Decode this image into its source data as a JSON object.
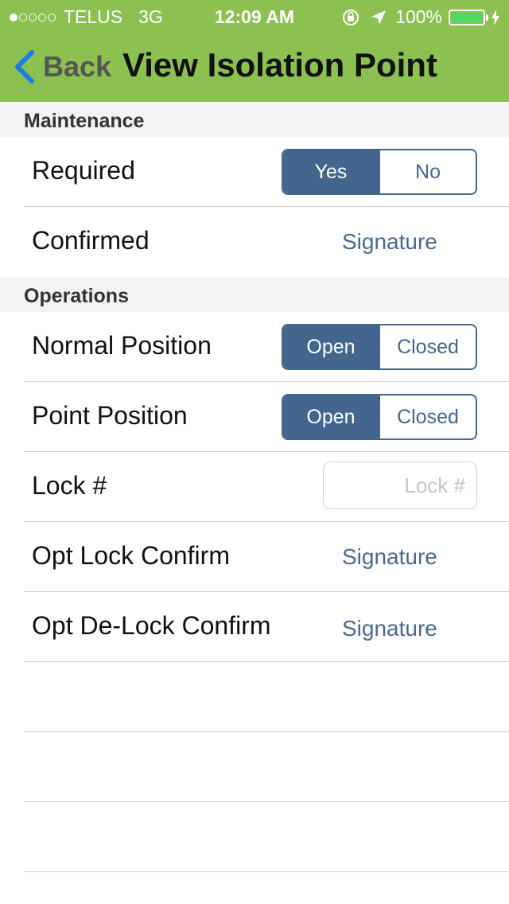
{
  "status_bar": {
    "signal_dots_filled": 1,
    "signal_dots_total": 5,
    "carrier": "TELUS",
    "network": "3G",
    "time": "12:09 AM",
    "icons": [
      "orientation-lock-icon",
      "location-arrow-icon"
    ],
    "battery_percent": "100%",
    "battery_level": 1.0,
    "battery_color": "#4cd964"
  },
  "nav": {
    "back_label": "Back",
    "title": "View Isolation Point",
    "bar_color": "#8cc152",
    "back_chevron_color": "#1e7ce8"
  },
  "sections": {
    "maintenance": "Maintenance",
    "operations": "Operations"
  },
  "maintenance": {
    "required": {
      "label": "Required",
      "options": [
        "Yes",
        "No"
      ],
      "selected": "Yes"
    },
    "confirmed": {
      "label": "Confirmed",
      "action": "Signature"
    }
  },
  "operations": {
    "normal_position": {
      "label": "Normal Position",
      "options": [
        "Open",
        "Closed"
      ],
      "selected": "Open"
    },
    "point_position": {
      "label": "Point Position",
      "options": [
        "Open",
        "Closed"
      ],
      "selected": "Open"
    },
    "lock": {
      "label": "Lock #",
      "value": "",
      "placeholder": "Lock #"
    },
    "opt_lock_confirm": {
      "label": "Opt Lock Confirm",
      "action": "Signature"
    },
    "opt_delock_confirm": {
      "label": "Opt De-Lock Confirm",
      "action": "Signature"
    }
  },
  "colors": {
    "segment_accent": "#43668f",
    "link": "#4a6a8e",
    "section_bg": "#f3f3f3"
  }
}
